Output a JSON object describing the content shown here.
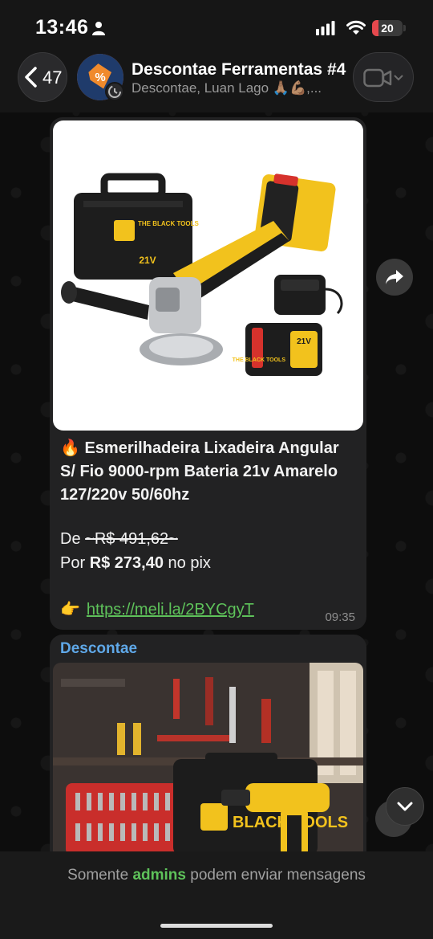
{
  "status_bar": {
    "time": "13:46",
    "battery_level": "20",
    "icons": [
      "person-icon",
      "signal-icon",
      "wifi-icon",
      "battery-icon"
    ]
  },
  "header": {
    "back_count": "47",
    "title": "Descontae Ferramentas #4",
    "subtitle": "Descontae, Luan Lago 🙏🏽💪🏽,..."
  },
  "messages": [
    {
      "title_emoji": "🔥",
      "title": "Esmerilhadeira Lixadeira Angular S/ Fio 9000-rpm Bateria 21v Amarelo 127/220v 50/60hz",
      "price_old_prefix": "De",
      "price_old": "~R$ 491,62~",
      "price_new_prefix": "Por",
      "price_new": "R$ 273,40",
      "price_new_suffix": "no pix",
      "link_emoji": "👉",
      "link": "https://meli.la/2BYCgyT",
      "time": "09:35",
      "image_text": {
        "case_brand": "THE BLACK TOOLS",
        "case_voltage": "21V",
        "battery_brand": "THE BLACK TOOLS",
        "battery_voltage": "21V"
      }
    },
    {
      "sender": "Descontae",
      "image_text": {
        "brand": "BLACK TOOLS"
      }
    }
  ],
  "footer": {
    "prefix": "Somente",
    "highlight": "admins",
    "suffix": "podem enviar mensagens"
  },
  "colors": {
    "accent_green": "#5ec25a",
    "sender_blue": "#5fa8e8",
    "battery_red": "#e5484d",
    "bubble": "#222223"
  }
}
